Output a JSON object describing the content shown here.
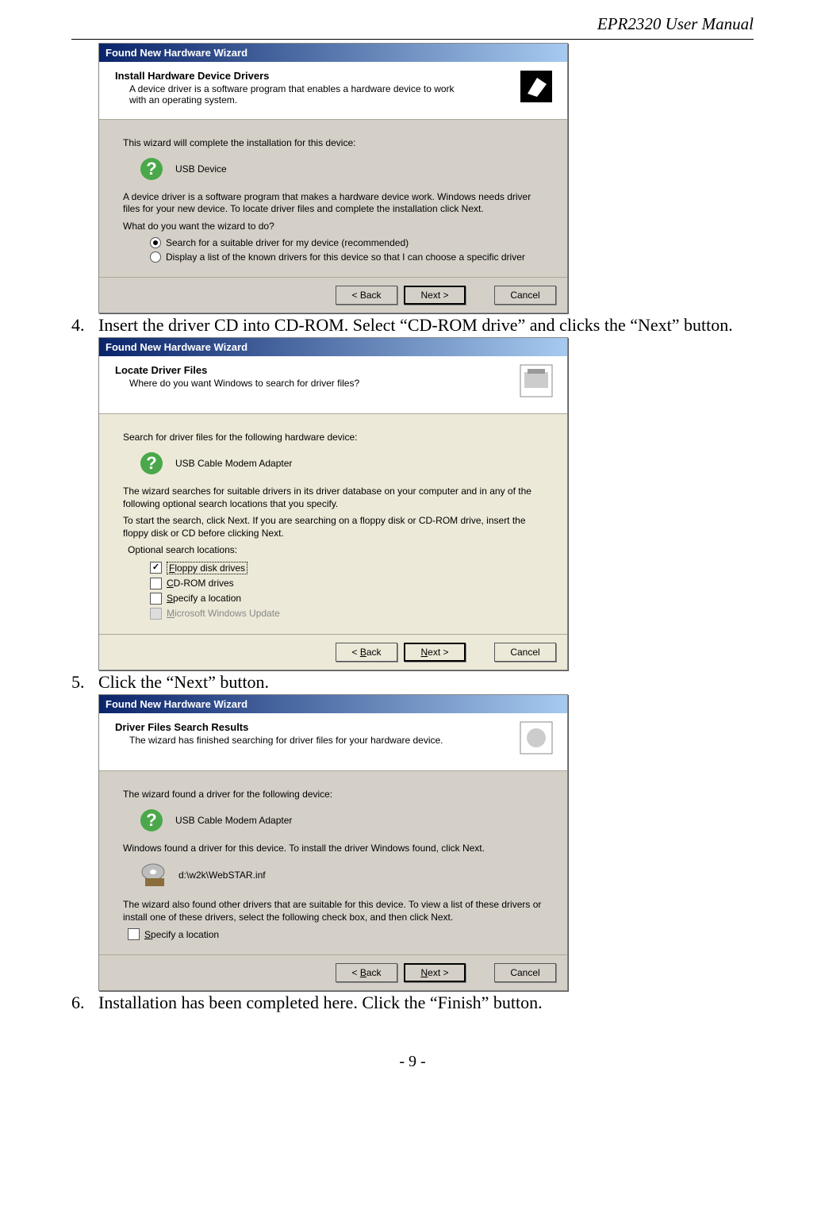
{
  "doc": {
    "header": "EPR2320 User Manual",
    "footer": "- 9 -"
  },
  "steps": {
    "s4_num": "4.",
    "s4_text": "Insert the driver CD into CD-ROM. Select “CD-ROM drive” and clicks the “Next” button.",
    "s5_num": "5.",
    "s5_text": "Click the “Next” button.",
    "s6_num": "6.",
    "s6_text": "Installation has been completed here. Click the “Finish” button."
  },
  "wiz1": {
    "title": "Found New Hardware Wizard",
    "h_title": "Install Hardware Device Drivers",
    "h_sub": "A device driver is a software program that enables a hardware device to work with an operating system.",
    "body_intro": "This wizard will complete the installation for this device:",
    "device": "USB Device",
    "body_desc": "A device driver is a software program that makes a hardware device work. Windows needs driver files for your new device. To locate driver files and complete the installation click Next.",
    "prompt": "What do you want the wizard to do?",
    "opt1": "Search for a suitable driver for my device (recommended)",
    "opt2": "Display a list of the known drivers for this device so that I can choose a specific driver",
    "back": "< Back",
    "next": "Next >",
    "cancel": "Cancel"
  },
  "wiz2": {
    "title": "Found New Hardware Wizard",
    "h_title": "Locate Driver Files",
    "h_sub": "Where do you want Windows to search for driver files?",
    "body_intro": "Search for driver files for the following hardware device:",
    "device": "USB Cable Modem Adapter",
    "body_p1": "The wizard searches for suitable drivers in its driver database on your computer and in any of the following optional search locations that you specify.",
    "body_p2": "To start the search, click Next. If you are searching on a floppy disk or CD-ROM drive, insert the floppy disk or CD before clicking Next.",
    "loc_label": "Optional search locations:",
    "opt1": "Floppy disk drives",
    "opt2": "CD-ROM drives",
    "opt3": "Specify a location",
    "opt4": "Microsoft Windows Update",
    "back": "< Back",
    "next": "Next >",
    "cancel": "Cancel"
  },
  "wiz3": {
    "title": "Found New Hardware Wizard",
    "h_title": "Driver Files Search Results",
    "h_sub": "The wizard has finished searching for driver files for your hardware device.",
    "body_intro": "The wizard found a driver for the following device:",
    "device": "USB Cable Modem Adapter",
    "body_p1": "Windows found a driver for this device. To install the driver Windows found, click Next.",
    "driver_path": "d:\\w2k\\WebSTAR.inf",
    "body_p2": "The wizard also found other drivers that are suitable for this device. To view a list of these drivers or install one of these drivers, select the following check box, and then click Next.",
    "specify": "Specify a location",
    "back": "< Back",
    "next": "Next >",
    "cancel": "Cancel"
  }
}
